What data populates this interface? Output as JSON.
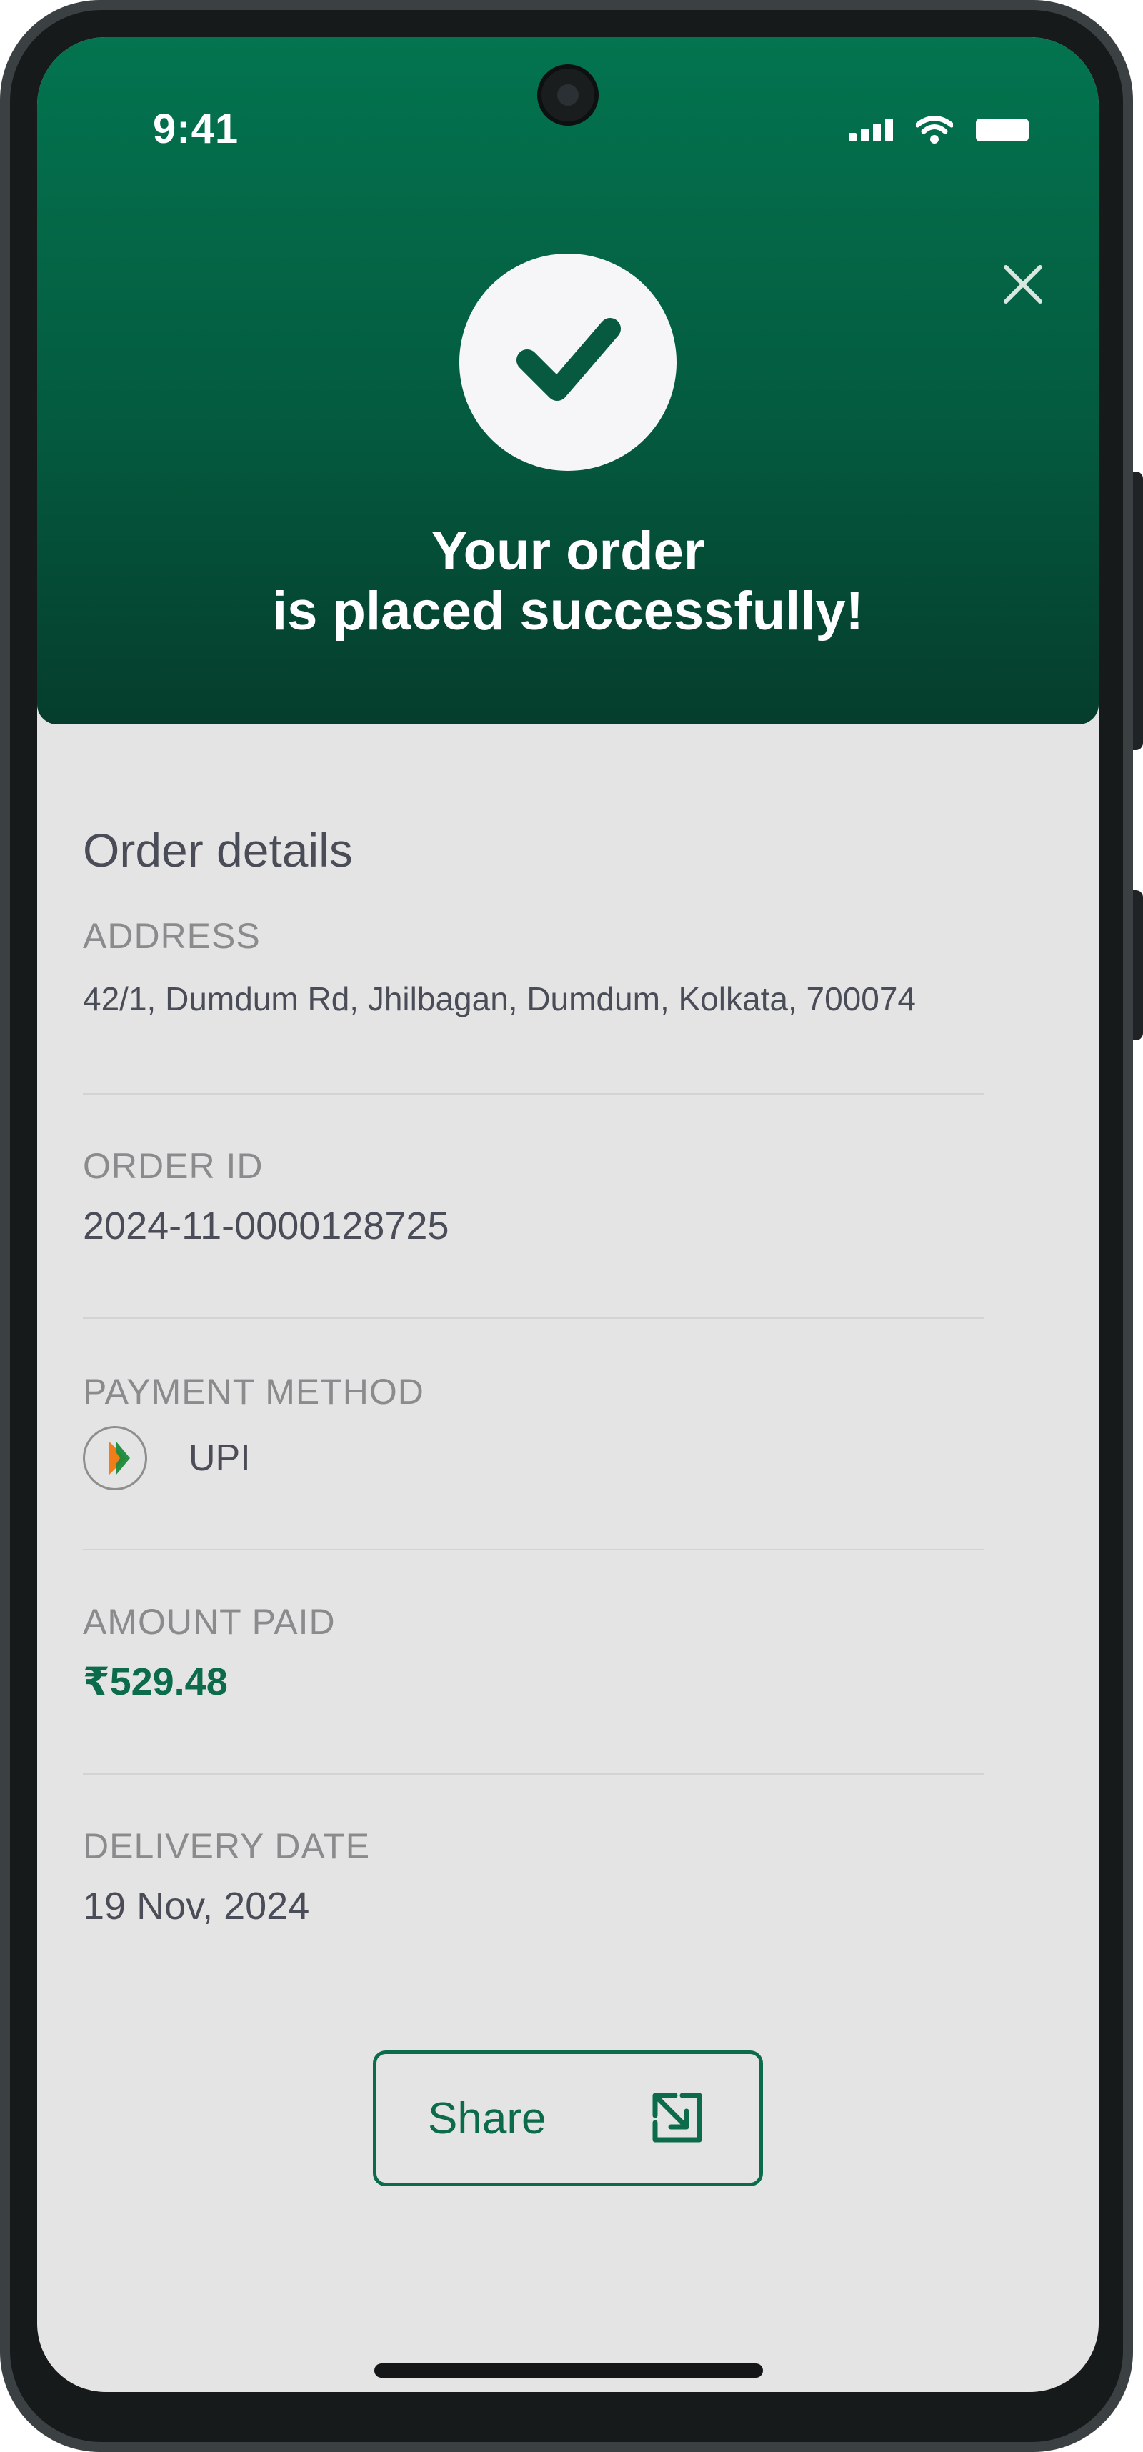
{
  "status_bar": {
    "time": "9:41"
  },
  "header": {
    "title_line1": "Your order",
    "title_line2": "is placed successfully!",
    "colors": {
      "gradient_top": "#03744f",
      "gradient_bottom": "#053d2c"
    }
  },
  "order_details": {
    "heading": "Order details",
    "address": {
      "label": "ADDRESS",
      "value": "42/1, Dumdum Rd, Jhilbagan, Dumdum, Kolkata, 700074"
    },
    "order_id": {
      "label": "ORDER ID",
      "value": "2024-11-0000128725"
    },
    "payment_method": {
      "label": "PAYMENT METHOD",
      "value": "UPI",
      "icon": "upi-logo-icon"
    },
    "amount_paid": {
      "label": "AMOUNT PAID",
      "value": "₹529.48"
    },
    "delivery_date": {
      "label": "DELIVERY DATE",
      "value": "19 Nov, 2024"
    }
  },
  "actions": {
    "share_label": "Share",
    "share_icon": "external-link-icon",
    "close_icon": "close-icon"
  },
  "accent_color": "#0b6b4b"
}
